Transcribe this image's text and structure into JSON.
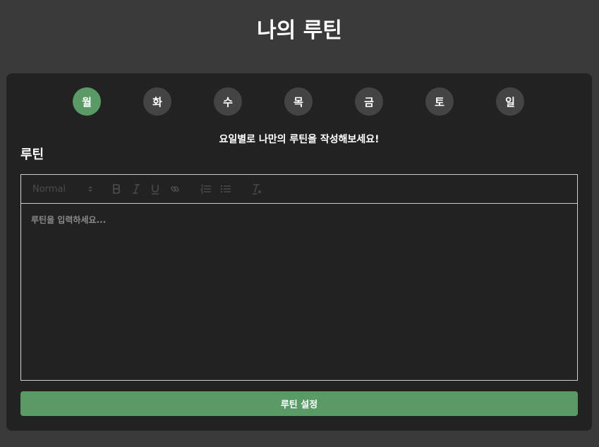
{
  "header": {
    "title": "나의 루틴"
  },
  "days": [
    {
      "label": "월",
      "active": true
    },
    {
      "label": "화",
      "active": false
    },
    {
      "label": "수",
      "active": false
    },
    {
      "label": "목",
      "active": false
    },
    {
      "label": "금",
      "active": false
    },
    {
      "label": "토",
      "active": false
    },
    {
      "label": "일",
      "active": false
    }
  ],
  "main": {
    "helper_text": "요일별로 나만의 루틴을 작성해보세요!",
    "section_label": "루틴"
  },
  "editor": {
    "format_value": "Normal",
    "placeholder": "루틴을 입력하세요...",
    "toolbar_icons": [
      "bold-icon",
      "italic-icon",
      "underline-icon",
      "link-icon",
      "ordered-list-icon",
      "bullet-list-icon",
      "clear-format-icon"
    ]
  },
  "actions": {
    "submit_label": "루틴 설정"
  },
  "colors": {
    "accent": "#5a9a67",
    "background": "#3a3a3a",
    "card": "#222222",
    "tab_inactive": "#444444"
  }
}
